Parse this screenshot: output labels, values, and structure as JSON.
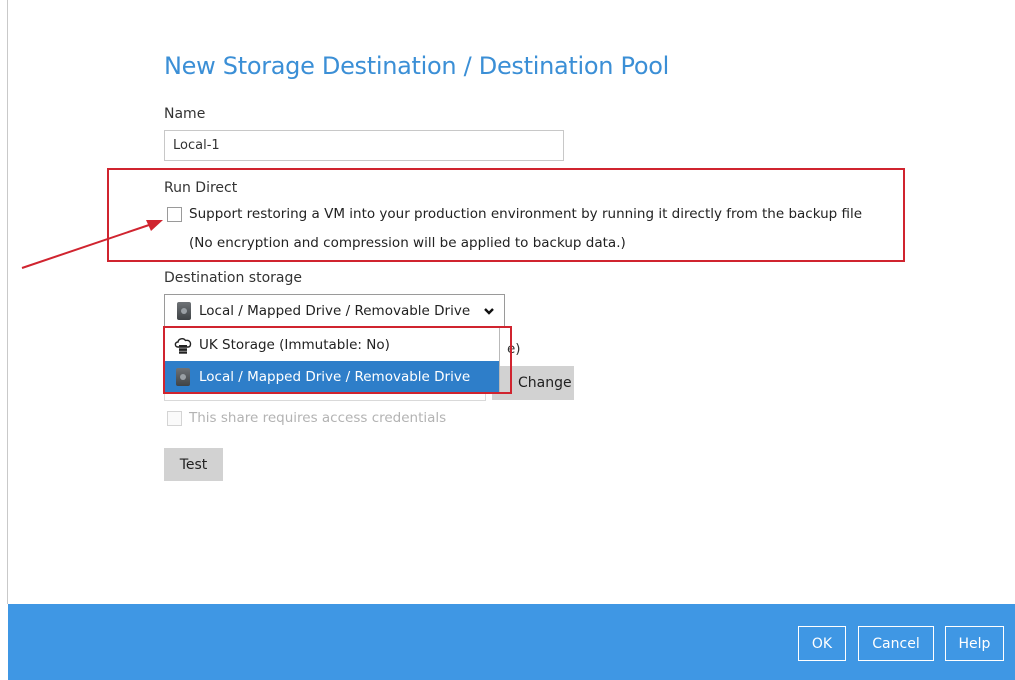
{
  "dialog": {
    "title": "New Storage Destination / Destination Pool"
  },
  "name_field": {
    "label": "Name",
    "value": "Local-1"
  },
  "run_direct": {
    "label": "Run Direct",
    "checkbox_label": "Support restoring a VM into your production environment by running it directly from the backup file",
    "note": "(No encryption and compression will be applied to backup data.)",
    "checked": false
  },
  "destination_storage": {
    "label": "Destination storage",
    "selected": "Local / Mapped Drive / Removable Drive",
    "options": [
      {
        "label": "UK Storage (Immutable: No)",
        "icon": "cloud-storage-icon"
      },
      {
        "label": "Local / Mapped Drive / Removable Drive",
        "icon": "hard-drive-icon"
      }
    ],
    "partial_text": "e)"
  },
  "change_button": {
    "label": "Change"
  },
  "credentials": {
    "label": "This share requires access credentials",
    "checked": false,
    "disabled": true
  },
  "test_button": {
    "label": "Test"
  },
  "footer": {
    "ok_label": "OK",
    "cancel_label": "Cancel",
    "help_label": "Help"
  },
  "colors": {
    "title": "#3b8fd6",
    "annotation": "#d0242f",
    "footer": "#3f97e4",
    "selected_option": "#2e7ec9"
  }
}
